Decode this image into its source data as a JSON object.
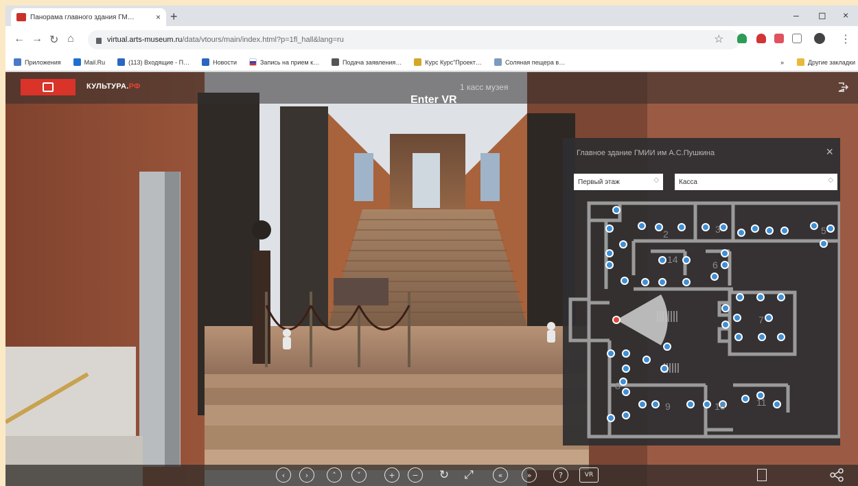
{
  "browser": {
    "tab_title": "Панорама главного здания ГМ…",
    "tab_close": "×",
    "new_tab": "+",
    "window_minimize": "–",
    "window_restore": "◻",
    "window_close": "×",
    "url_domain": "virtual.arts-museum.ru",
    "url_path": "/data/vtours/main/index.html?p=1fl_hall&lang=ru",
    "bookmarks": [
      {
        "label": "Приложения",
        "color": "#4a79c9"
      },
      {
        "label": "Mail.Ru",
        "color": "#1f6fd1"
      },
      {
        "label": "(113) Входящие - П…",
        "color": "#2b66c2"
      },
      {
        "label": "Новости",
        "color": "#2b66c2"
      },
      {
        "label": "Запись на прием к…",
        "color": "#c43a3a"
      },
      {
        "label": "Подача заявления…",
        "color": "#555555"
      },
      {
        "label": "Курс Курс\"Проект…",
        "color": "#d4a62a"
      },
      {
        "label": "Соляная пещера в…",
        "color": "#7c9cbf"
      }
    ],
    "bookmarks_more": "»",
    "bookmarks_other": "Другие закладки"
  },
  "tour": {
    "brand_main": "КУЛЬТУРА.",
    "brand_suffix": "РФ",
    "place_label": "1 касс музея",
    "enter_vr": "Enter VR"
  },
  "map_panel": {
    "title": "Главное здание ГМИИ им А.С.Пушкина",
    "close": "×",
    "floor_select": "Первый этаж",
    "room_select": "Касса",
    "room_numbers": [
      "2",
      "3",
      "5",
      "6",
      "7",
      "8",
      "9",
      "10",
      "11",
      "14"
    ]
  },
  "controls": {
    "buttons": [
      "‹",
      "›",
      "˄",
      "˅",
      "+",
      "−",
      "↻",
      "⤢",
      "«",
      "»",
      "?",
      "VR"
    ]
  }
}
